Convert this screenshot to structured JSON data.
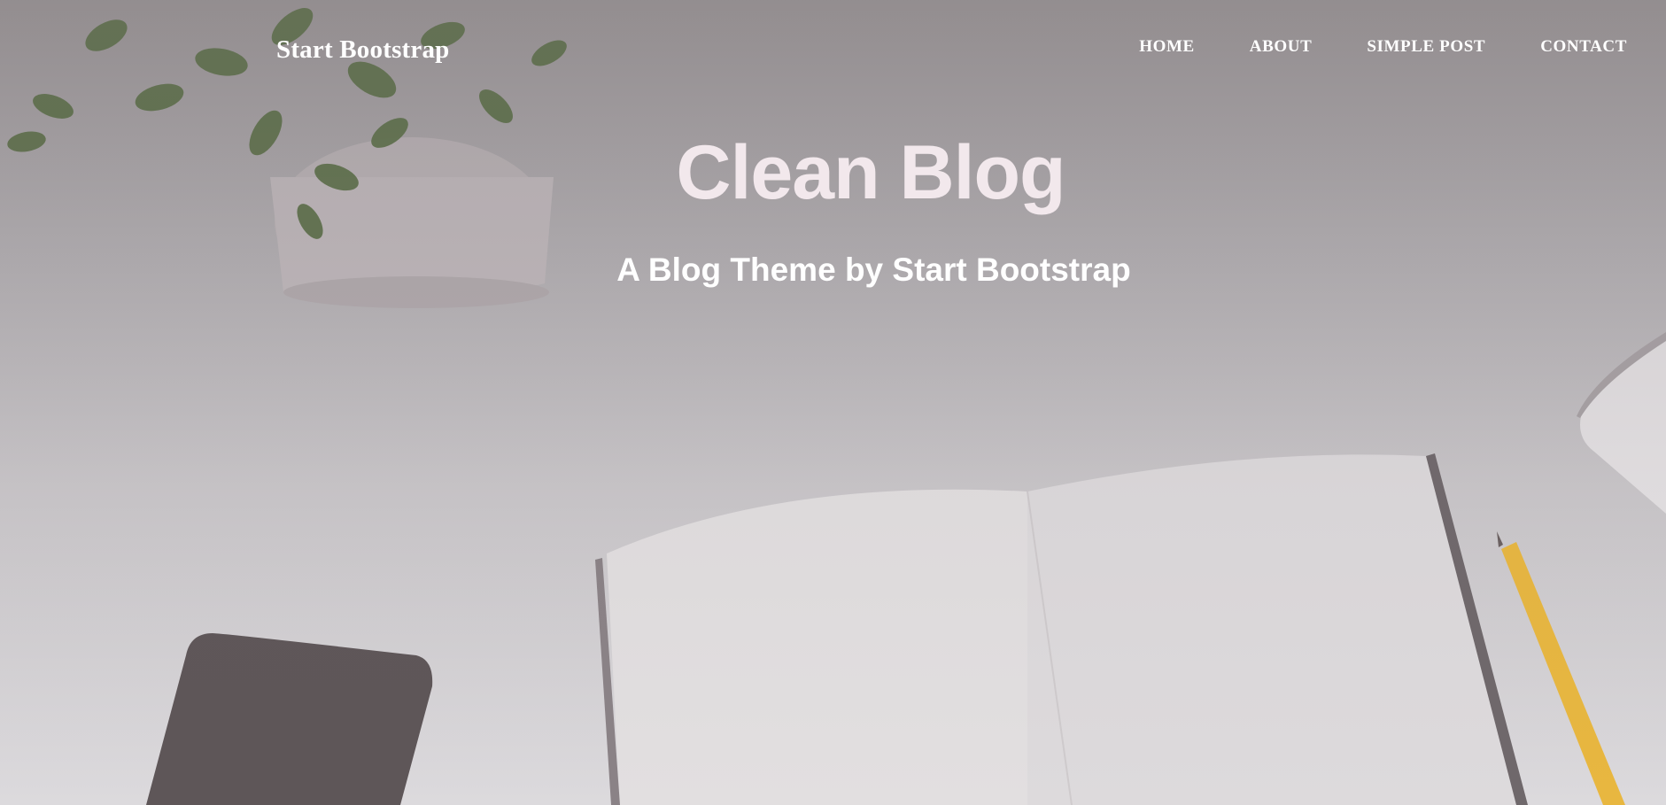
{
  "navbar": {
    "brand": "Start Bootstrap",
    "links": [
      {
        "label": "HOME"
      },
      {
        "label": "ABOUT"
      },
      {
        "label": "SIMPLE POST"
      },
      {
        "label": "CONTACT"
      }
    ]
  },
  "header": {
    "title": "Clean Blog",
    "subtitle": "A Blog Theme by Start Bootstrap"
  },
  "colors": {
    "title": "#f2e8ec",
    "nav_text": "#ffffff"
  }
}
